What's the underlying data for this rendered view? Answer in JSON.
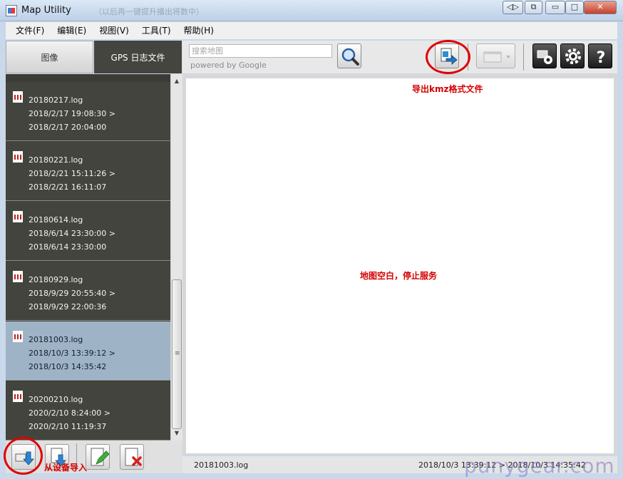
{
  "window": {
    "title": "Map Utility",
    "subtitle": "（以后再一键提升播出将数中）",
    "controls": {
      "nav": "◁▷",
      "restore_small": "⧉",
      "minimize": "▭",
      "maximize": "□",
      "close": "✕"
    }
  },
  "menu": [
    {
      "label": "文件(F)"
    },
    {
      "label": "编辑(E)"
    },
    {
      "label": "视图(V)"
    },
    {
      "label": "工具(T)"
    },
    {
      "label": "帮助(H)"
    }
  ],
  "tabs": [
    {
      "label": "图像",
      "active": false
    },
    {
      "label": "GPS 日志文件",
      "active": true
    }
  ],
  "search": {
    "placeholder": "搜索地图",
    "value": "",
    "powered_by": "powered by Google"
  },
  "log_files": [
    {
      "name": "20180217.log",
      "start": "2018/2/17 19:08:30 >",
      "end": "2018/2/17 20:04:00",
      "selected": false
    },
    {
      "name": "20180221.log",
      "start": "2018/2/21 15:11:26 >",
      "end": "2018/2/21 16:11:07",
      "selected": false
    },
    {
      "name": "20180614.log",
      "start": "2018/6/14 23:30:00 >",
      "end": "2018/6/14 23:30:00",
      "selected": false
    },
    {
      "name": "20180929.log",
      "start": "2018/9/29 20:55:40 >",
      "end": "2018/9/29 22:00:36",
      "selected": false
    },
    {
      "name": "20181003.log",
      "start": "2018/10/3 13:39:12 >",
      "end": "2018/10/3 14:35:42",
      "selected": true
    },
    {
      "name": "20200210.log",
      "start": "2020/2/10 8:24:00 >",
      "end": "2020/2/10 11:19:37",
      "selected": false
    }
  ],
  "status": {
    "file": "20181003.log",
    "range": "2018/10/3 13:39:12 > 2018/10/3 14:35:42"
  },
  "annotations": {
    "export": "导出kmz格式文件",
    "map_blank": "地图空白，停止服务",
    "import": "从设备导入"
  },
  "watermark": "punygear.com",
  "colors": {
    "list_bg": "#44443f",
    "selected_bg": "#9fb3c6",
    "annotation": "#d40000"
  }
}
